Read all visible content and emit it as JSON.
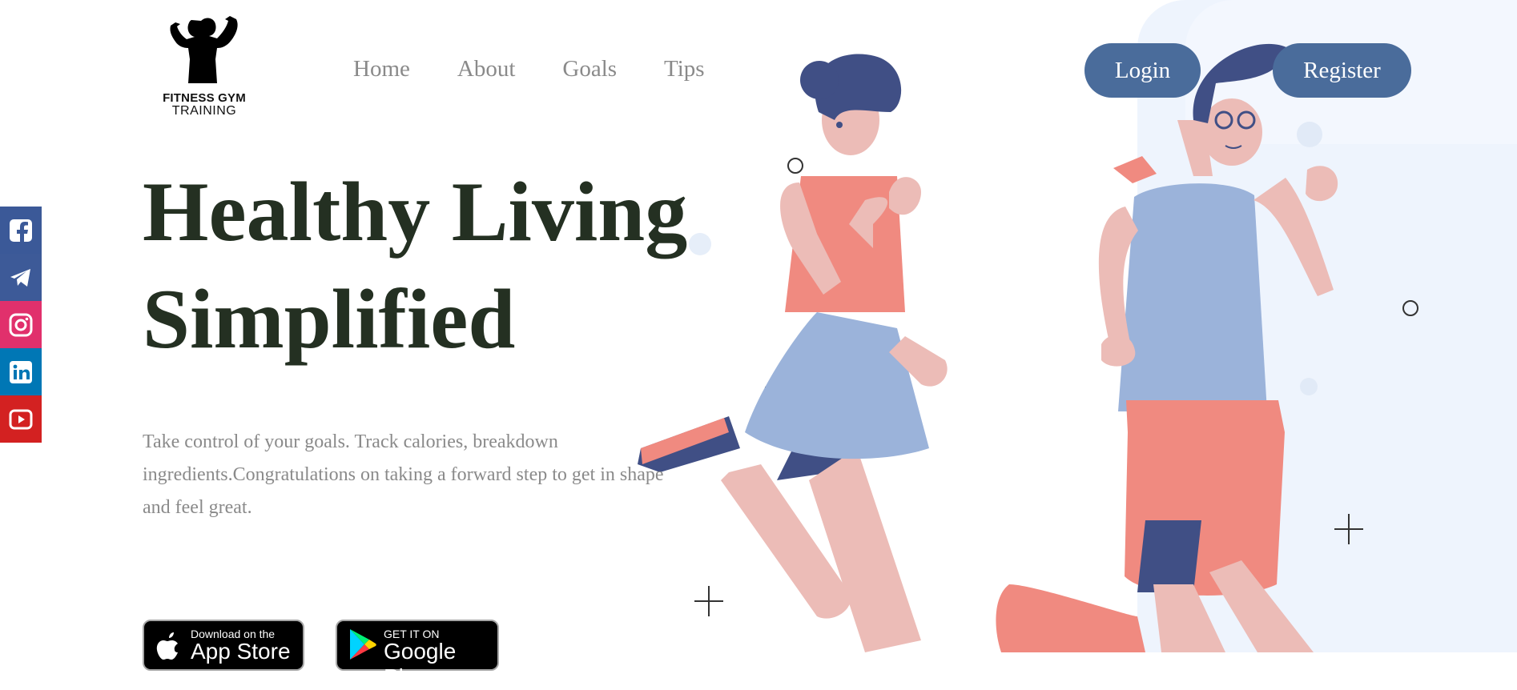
{
  "brand": {
    "name": "FITNESS GYM",
    "tagline": "TRAINING"
  },
  "nav": {
    "items": [
      "Home",
      "About",
      "Goals",
      "Tips"
    ]
  },
  "auth": {
    "login_label": "Login",
    "register_label": "Register"
  },
  "social": [
    {
      "icon": "facebook-icon",
      "color": "#3b5998"
    },
    {
      "icon": "telegram-icon",
      "color": "#3d5a98"
    },
    {
      "icon": "instagram-icon",
      "color": "#e1306c"
    },
    {
      "icon": "linkedin-icon",
      "color": "#0077b5"
    },
    {
      "icon": "youtube-icon",
      "color": "#d32121"
    }
  ],
  "hero": {
    "title_line1": "Healthy Living",
    "title_line2": "Simplified",
    "description": "Take control of your goals. Track calories, breakdown ingredients.Congratulations on taking a forward step to get in shape and feel great."
  },
  "stores": {
    "apple_small": "Download on the",
    "apple_big": "App Store",
    "google_small": "GET IT ON",
    "google_big": "Google Play"
  },
  "colors": {
    "accent": "#4a6c9b",
    "heading": "#243022",
    "muted_text": "#8a8a8a",
    "panel_bg": "#eef4fd"
  }
}
